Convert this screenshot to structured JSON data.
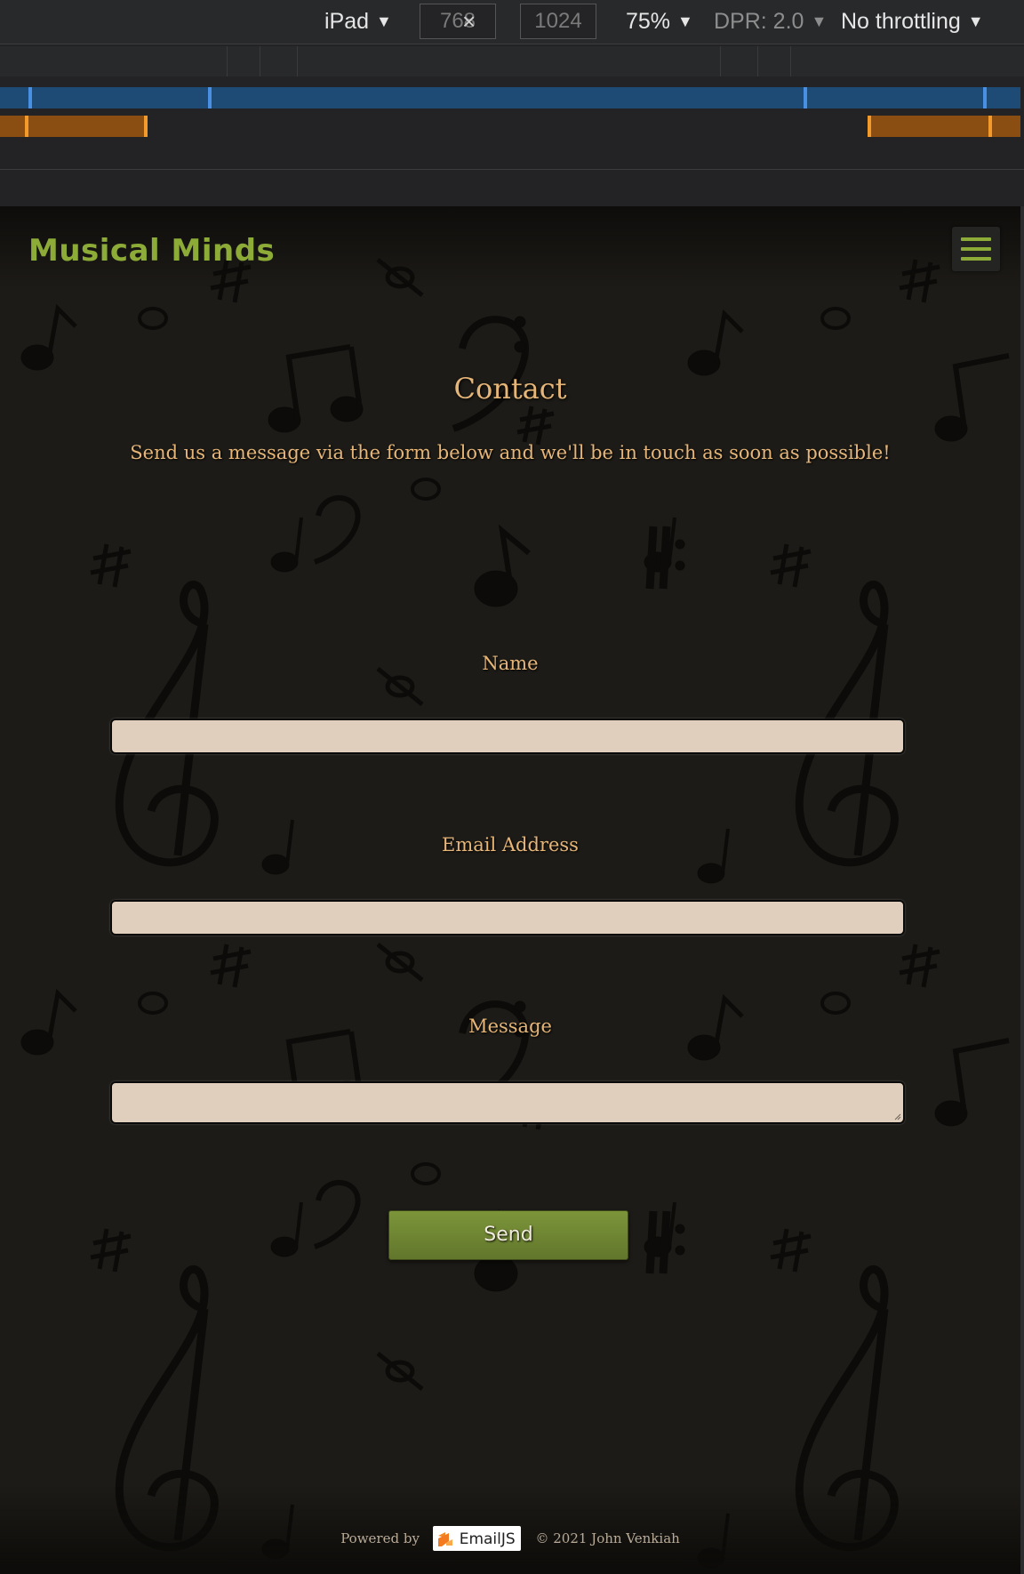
{
  "devtools": {
    "device": "iPad",
    "width": "768",
    "height": "1024",
    "times": "×",
    "zoom": "75%",
    "dpr": "DPR: 2.0",
    "throttling": "No throttling"
  },
  "site": {
    "logo": "Musical Minds",
    "menu_icon": "hamburger-menu-icon",
    "title": "Contact",
    "intro": "Send us a message via the form below and we'll be in touch as soon as possible!",
    "form": {
      "name_label": "Name",
      "email_label": "Email Address",
      "message_label": "Message",
      "send_label": "Send"
    },
    "footer": {
      "powered_by": "Powered by",
      "emailjs": "EmailJS",
      "copyright": "© 2021 John Venkiah"
    },
    "colors": {
      "accent_green": "#8cab37",
      "heading_tan": "#e6b678",
      "input_bg": "#e0cfbd",
      "background": "#1d1b17"
    }
  }
}
